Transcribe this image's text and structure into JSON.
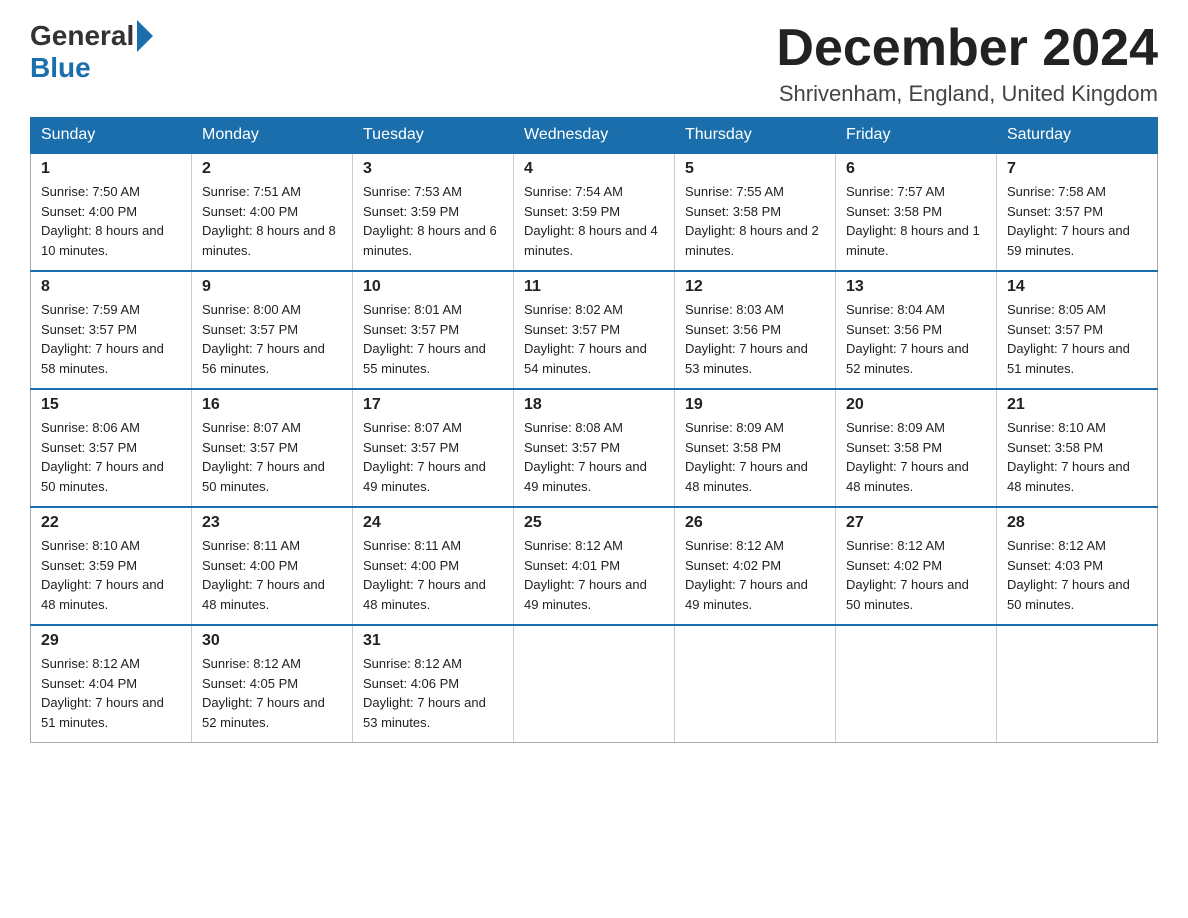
{
  "header": {
    "logo_general": "General",
    "logo_blue": "Blue",
    "month_title": "December 2024",
    "location": "Shrivenham, England, United Kingdom"
  },
  "days_of_week": [
    "Sunday",
    "Monday",
    "Tuesday",
    "Wednesday",
    "Thursday",
    "Friday",
    "Saturday"
  ],
  "weeks": [
    [
      {
        "day": "1",
        "sunrise": "7:50 AM",
        "sunset": "4:00 PM",
        "daylight": "8 hours and 10 minutes."
      },
      {
        "day": "2",
        "sunrise": "7:51 AM",
        "sunset": "4:00 PM",
        "daylight": "8 hours and 8 minutes."
      },
      {
        "day": "3",
        "sunrise": "7:53 AM",
        "sunset": "3:59 PM",
        "daylight": "8 hours and 6 minutes."
      },
      {
        "day": "4",
        "sunrise": "7:54 AM",
        "sunset": "3:59 PM",
        "daylight": "8 hours and 4 minutes."
      },
      {
        "day": "5",
        "sunrise": "7:55 AM",
        "sunset": "3:58 PM",
        "daylight": "8 hours and 2 minutes."
      },
      {
        "day": "6",
        "sunrise": "7:57 AM",
        "sunset": "3:58 PM",
        "daylight": "8 hours and 1 minute."
      },
      {
        "day": "7",
        "sunrise": "7:58 AM",
        "sunset": "3:57 PM",
        "daylight": "7 hours and 59 minutes."
      }
    ],
    [
      {
        "day": "8",
        "sunrise": "7:59 AM",
        "sunset": "3:57 PM",
        "daylight": "7 hours and 58 minutes."
      },
      {
        "day": "9",
        "sunrise": "8:00 AM",
        "sunset": "3:57 PM",
        "daylight": "7 hours and 56 minutes."
      },
      {
        "day": "10",
        "sunrise": "8:01 AM",
        "sunset": "3:57 PM",
        "daylight": "7 hours and 55 minutes."
      },
      {
        "day": "11",
        "sunrise": "8:02 AM",
        "sunset": "3:57 PM",
        "daylight": "7 hours and 54 minutes."
      },
      {
        "day": "12",
        "sunrise": "8:03 AM",
        "sunset": "3:56 PM",
        "daylight": "7 hours and 53 minutes."
      },
      {
        "day": "13",
        "sunrise": "8:04 AM",
        "sunset": "3:56 PM",
        "daylight": "7 hours and 52 minutes."
      },
      {
        "day": "14",
        "sunrise": "8:05 AM",
        "sunset": "3:57 PM",
        "daylight": "7 hours and 51 minutes."
      }
    ],
    [
      {
        "day": "15",
        "sunrise": "8:06 AM",
        "sunset": "3:57 PM",
        "daylight": "7 hours and 50 minutes."
      },
      {
        "day": "16",
        "sunrise": "8:07 AM",
        "sunset": "3:57 PM",
        "daylight": "7 hours and 50 minutes."
      },
      {
        "day": "17",
        "sunrise": "8:07 AM",
        "sunset": "3:57 PM",
        "daylight": "7 hours and 49 minutes."
      },
      {
        "day": "18",
        "sunrise": "8:08 AM",
        "sunset": "3:57 PM",
        "daylight": "7 hours and 49 minutes."
      },
      {
        "day": "19",
        "sunrise": "8:09 AM",
        "sunset": "3:58 PM",
        "daylight": "7 hours and 48 minutes."
      },
      {
        "day": "20",
        "sunrise": "8:09 AM",
        "sunset": "3:58 PM",
        "daylight": "7 hours and 48 minutes."
      },
      {
        "day": "21",
        "sunrise": "8:10 AM",
        "sunset": "3:58 PM",
        "daylight": "7 hours and 48 minutes."
      }
    ],
    [
      {
        "day": "22",
        "sunrise": "8:10 AM",
        "sunset": "3:59 PM",
        "daylight": "7 hours and 48 minutes."
      },
      {
        "day": "23",
        "sunrise": "8:11 AM",
        "sunset": "4:00 PM",
        "daylight": "7 hours and 48 minutes."
      },
      {
        "day": "24",
        "sunrise": "8:11 AM",
        "sunset": "4:00 PM",
        "daylight": "7 hours and 48 minutes."
      },
      {
        "day": "25",
        "sunrise": "8:12 AM",
        "sunset": "4:01 PM",
        "daylight": "7 hours and 49 minutes."
      },
      {
        "day": "26",
        "sunrise": "8:12 AM",
        "sunset": "4:02 PM",
        "daylight": "7 hours and 49 minutes."
      },
      {
        "day": "27",
        "sunrise": "8:12 AM",
        "sunset": "4:02 PM",
        "daylight": "7 hours and 50 minutes."
      },
      {
        "day": "28",
        "sunrise": "8:12 AM",
        "sunset": "4:03 PM",
        "daylight": "7 hours and 50 minutes."
      }
    ],
    [
      {
        "day": "29",
        "sunrise": "8:12 AM",
        "sunset": "4:04 PM",
        "daylight": "7 hours and 51 minutes."
      },
      {
        "day": "30",
        "sunrise": "8:12 AM",
        "sunset": "4:05 PM",
        "daylight": "7 hours and 52 minutes."
      },
      {
        "day": "31",
        "sunrise": "8:12 AM",
        "sunset": "4:06 PM",
        "daylight": "7 hours and 53 minutes."
      },
      null,
      null,
      null,
      null
    ]
  ]
}
